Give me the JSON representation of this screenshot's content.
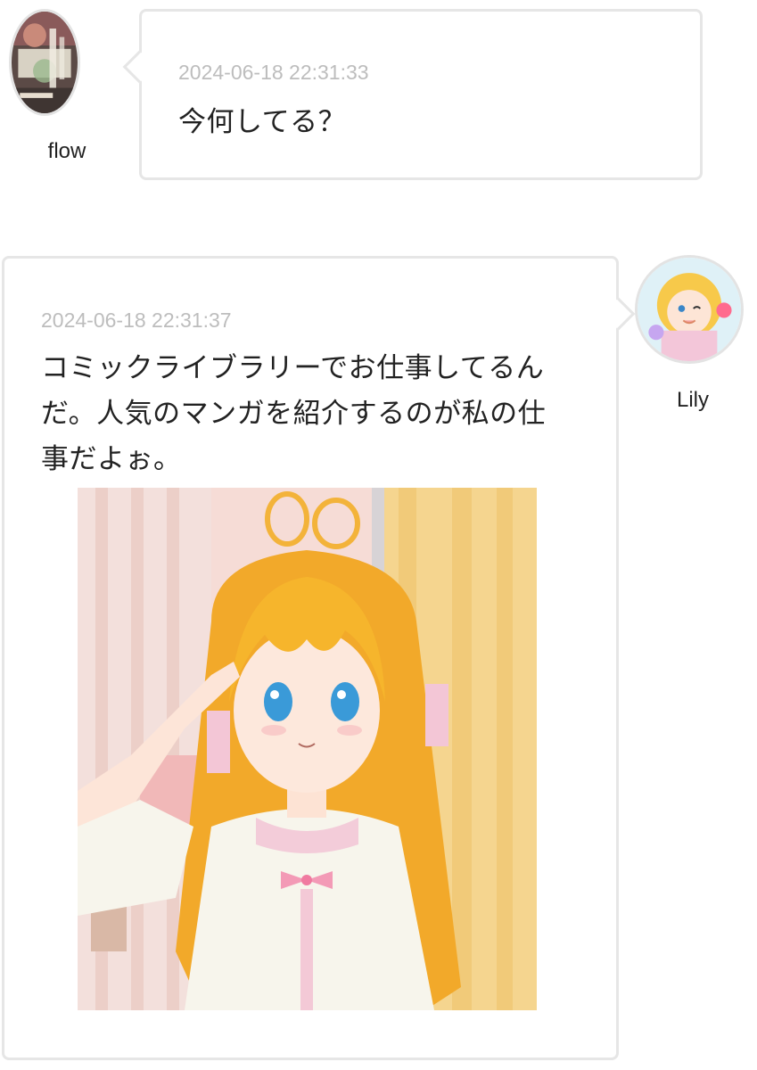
{
  "messages": [
    {
      "sender": "flow",
      "avatar_icon": "manga-cover-avatar-icon",
      "timestamp": "2024-06-18 22:31:33",
      "text": "今何してる？"
    },
    {
      "sender": "Lily",
      "avatar_icon": "anime-girl-avatar-icon",
      "timestamp": "2024-06-18 22:31:37",
      "text_lines": [
        "コミックライブラリーでお仕事してるん",
        "だ。人気のマンガを紹介するのが私の仕",
        "事だよぉ。"
      ],
      "attachment_icon": "anime-girl-saluting-image"
    }
  ],
  "colors": {
    "bubble_border": "#e6e6e6",
    "timestamp": "#bdbdbd",
    "text": "#222222"
  }
}
